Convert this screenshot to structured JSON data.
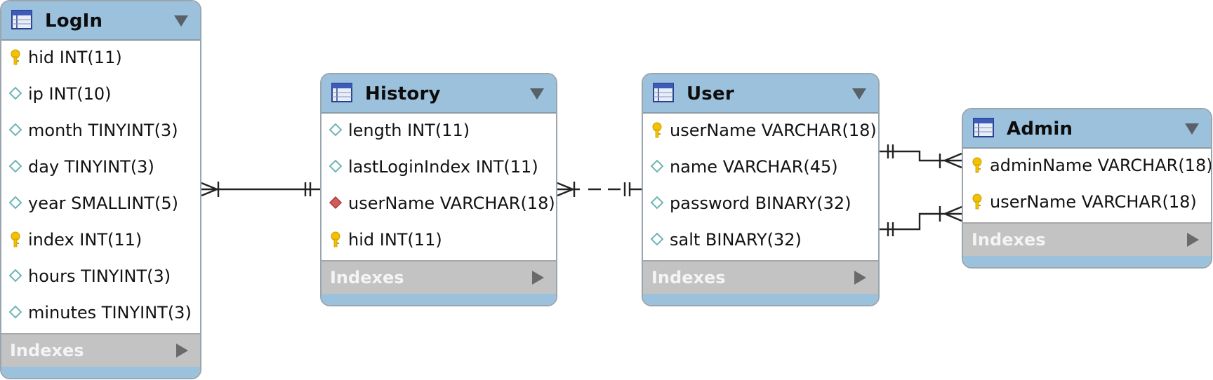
{
  "tables": [
    {
      "name": "LogIn",
      "columns": [
        {
          "text": "hid INT(11)",
          "icon": "primary-key-icon"
        },
        {
          "text": "ip INT(10)",
          "icon": "column-diamond-icon"
        },
        {
          "text": "month TINYINT(3)",
          "icon": "column-diamond-icon"
        },
        {
          "text": "day TINYINT(3)",
          "icon": "column-diamond-icon"
        },
        {
          "text": "year SMALLINT(5)",
          "icon": "column-diamond-icon"
        },
        {
          "text": "index INT(11)",
          "icon": "primary-key-icon"
        },
        {
          "text": "hours TINYINT(3)",
          "icon": "column-diamond-icon"
        },
        {
          "text": "minutes TINYINT(3)",
          "icon": "column-diamond-icon"
        }
      ],
      "indexes_label": "Indexes"
    },
    {
      "name": "History",
      "columns": [
        {
          "text": "length INT(11)",
          "icon": "column-diamond-icon"
        },
        {
          "text": "lastLoginIndex INT(11)",
          "icon": "column-diamond-icon"
        },
        {
          "text": "userName VARCHAR(18)",
          "icon": "foreign-key-diamond-icon"
        },
        {
          "text": "hid INT(11)",
          "icon": "primary-key-icon"
        }
      ],
      "indexes_label": "Indexes"
    },
    {
      "name": "User",
      "columns": [
        {
          "text": "userName VARCHAR(18)",
          "icon": "primary-key-icon"
        },
        {
          "text": "name VARCHAR(45)",
          "icon": "column-diamond-icon"
        },
        {
          "text": "password BINARY(32)",
          "icon": "column-diamond-icon"
        },
        {
          "text": "salt BINARY(32)",
          "icon": "column-diamond-icon"
        }
      ],
      "indexes_label": "Indexes"
    },
    {
      "name": "Admin",
      "columns": [
        {
          "text": "adminName VARCHAR(18)",
          "icon": "primary-key-icon"
        },
        {
          "text": "userName VARCHAR(18)",
          "icon": "primary-key-icon"
        }
      ],
      "indexes_label": "Indexes"
    }
  ],
  "relationships": [
    {
      "from": "LogIn",
      "to": "History",
      "style": "solid",
      "from_end": "one-or-many",
      "to_end": "exactly-one"
    },
    {
      "from": "History",
      "to": "User",
      "style": "dashed",
      "from_end": "one-or-many",
      "to_end": "exactly-one"
    },
    {
      "from": "User",
      "to": "Admin",
      "style": "solid",
      "from_end": "exactly-one",
      "to_end": "one-or-many"
    },
    {
      "from": "User",
      "to": "Admin",
      "style": "solid",
      "from_end": "exactly-one",
      "to_end": "one-or-many"
    }
  ],
  "colors": {
    "header": "#9cc1dc",
    "indexes_bar": "#c3c3c3",
    "key_icon": "#f2c200",
    "column_diamond": "#6fb5b5",
    "fk_diamond": "#d45a5a",
    "line": "#222222"
  }
}
